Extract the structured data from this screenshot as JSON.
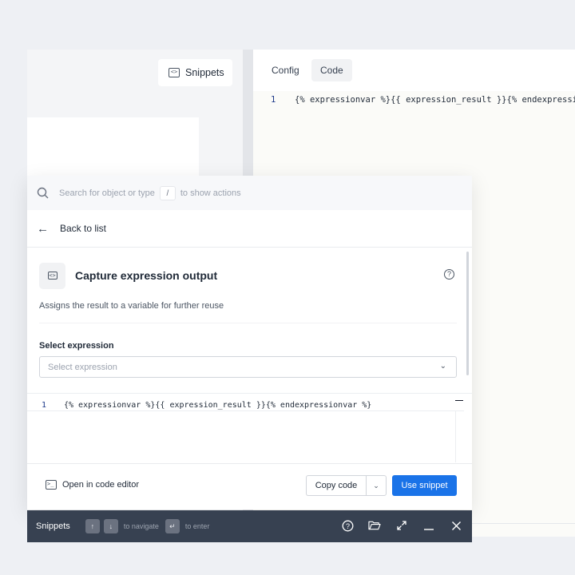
{
  "background": {
    "snippets_button_label": "Snippets",
    "tabs": [
      {
        "label": "Config"
      },
      {
        "label": "Code"
      }
    ],
    "active_tab": "Code",
    "code": {
      "line_number": "1",
      "text": "{% expressionvar  %}{{ expression_result }}{% endexpressionvar %}"
    }
  },
  "panel": {
    "search": {
      "placeholder_before": "Search for object or type",
      "key": "/",
      "placeholder_after": "to show actions"
    },
    "back_label": "Back to list",
    "snippet": {
      "title": "Capture expression output",
      "description": "Assigns the result to a variable for further reuse",
      "select_label": "Select expression",
      "select_placeholder": "Select expression",
      "code": {
        "line_number": "1",
        "text": "{% expressionvar  %}{{ expression_result }}{% endexpressionvar %}"
      }
    },
    "footer": {
      "open_editor_label": "Open in code editor",
      "copy_label": "Copy code",
      "use_label": "Use snippet"
    }
  },
  "bottom_bar": {
    "title": "Snippets",
    "navigate_hint": "to navigate",
    "enter_hint": "to enter",
    "icons": [
      "help-icon",
      "folder-open-icon",
      "expand-icon",
      "minimize-icon",
      "close-icon"
    ]
  },
  "colors": {
    "accent": "#1a73e8",
    "bottom_bar": "#374151"
  }
}
